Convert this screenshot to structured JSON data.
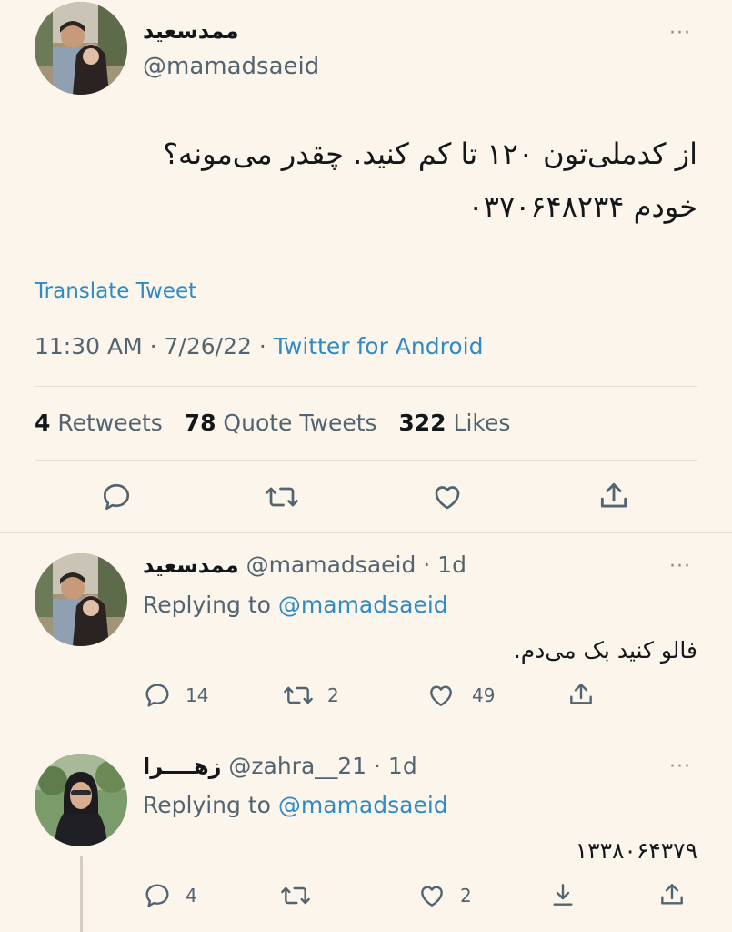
{
  "main_tweet": {
    "display_name": "ممدسعید",
    "handle": "@mamadsaeid",
    "more": "···",
    "text_line1": "از کدملی‌تون ۱۲۰ تا کم کنید. چقدر می‌مونه؟",
    "text_line2": "خودم ۰۳۷۰۶۴۸۲۳۴",
    "translate": "Translate Tweet",
    "time": "11:30 AM · 7/26/22 · ",
    "source": "Twitter for Android",
    "stats": {
      "retweets_count": "4",
      "retweets_label": "Retweets",
      "quotes_count": "78",
      "quotes_label": "Quote Tweets",
      "likes_count": "322",
      "likes_label": "Likes"
    }
  },
  "reply1": {
    "display_name": "ممدسعید",
    "handle_time": "@mamadsaeid · 1d",
    "more": "···",
    "replying_prefix": "Replying to ",
    "replying_handle": "@mamadsaeid",
    "text": "فالو کنید بک می‌دم.",
    "replies": "14",
    "retweets": "2",
    "likes": "49"
  },
  "reply2": {
    "display_name": "زهــــرا",
    "handle_time": "@zahra__21 · 1d",
    "more": "···",
    "replying_prefix": "Replying to ",
    "replying_handle": "@mamadsaeid",
    "text": "۱۳۳۸۰۶۴۳۷۹",
    "replies": "4",
    "likes": "2"
  },
  "colors": {
    "background": "#fcf5ec",
    "link_blue": "#2e8bc4",
    "secondary_text": "#536471"
  }
}
